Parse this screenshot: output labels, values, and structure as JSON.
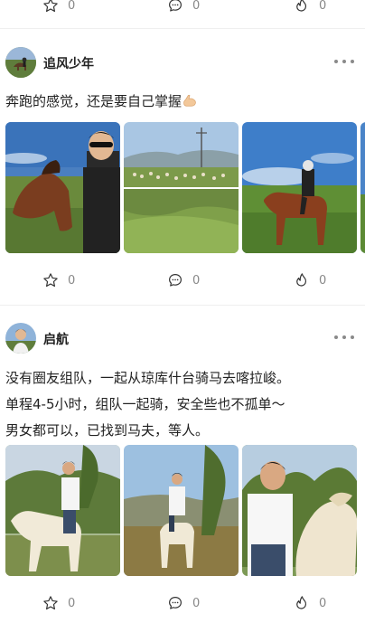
{
  "top_actions": {
    "star_count": "0",
    "comment_count": "0",
    "like_count": "0"
  },
  "posts": [
    {
      "username": "追风少年",
      "text_lines": [
        "奔跑的感觉，还是要自己掌握"
      ],
      "emoji": "flexed-biceps",
      "star_count": "0",
      "comment_count": "0",
      "like_count": "0"
    },
    {
      "username": "启航",
      "text_lines": [
        "没有圈友组队，一起从琼库什台骑马去喀拉峻。",
        "单程4-5小时，组队一起骑，安全些也不孤单～",
        "男女都可以，已找到马夫，等人。"
      ],
      "star_count": "0",
      "comment_count": "0",
      "like_count": "0"
    }
  ],
  "icons": {
    "star": "star-icon",
    "comment": "comment-icon",
    "like": "flame-like-icon",
    "more": "more-dots-icon"
  },
  "colors": {
    "icon_gray": "#888888",
    "divider": "#efefef",
    "text": "#222222"
  }
}
